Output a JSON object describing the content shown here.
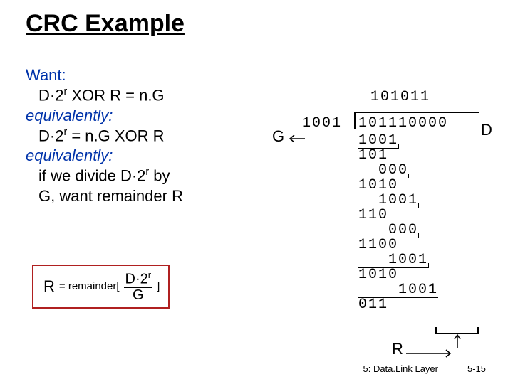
{
  "title": "CRC Example",
  "lines": {
    "want": "Want:",
    "l1": "D·2r XOR R = n.G",
    "eq1": "equivalently:",
    "l2": "D·2r = n.G XOR R",
    "eq2": "equivalently:",
    "l3a": "if we divide D·2r by",
    "l3b": "G, want remainder R"
  },
  "formula": {
    "R": "R",
    "eq": "= remainder[",
    "num_before": "D·2",
    "num_sup": "r",
    "den": "G",
    "close": "]"
  },
  "labels": {
    "G": "G",
    "D": "D",
    "R": "R"
  },
  "div": {
    "quotient": "101011",
    "divisor": "1001",
    "dividend": "101110000",
    "work": [
      "1001",
      " 101",
      " 000",
      " 1010",
      " 1001",
      "  110",
      "  000",
      "  1100",
      "  1001",
      "   1010",
      "   1001",
      "    011"
    ]
  },
  "footer": {
    "left": "5: Data.Link Layer",
    "right": "5-15"
  }
}
